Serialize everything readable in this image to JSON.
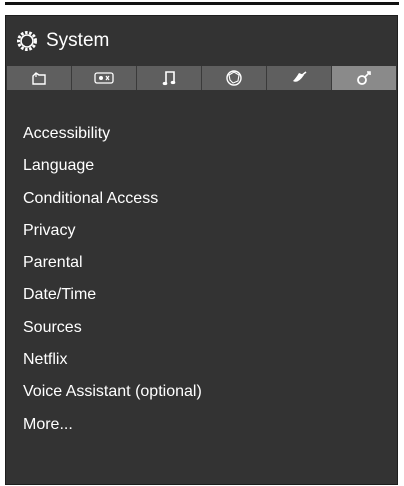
{
  "header": {
    "title": "System",
    "icon": "gear-icon"
  },
  "tabs": [
    {
      "icon": "picture-icon",
      "active": false
    },
    {
      "icon": "sound-display-icon",
      "active": false
    },
    {
      "icon": "music-note-icon",
      "active": false
    },
    {
      "icon": "network-globe-icon",
      "active": false
    },
    {
      "icon": "satellite-dish-icon",
      "active": false
    },
    {
      "icon": "system-tools-icon",
      "active": true
    }
  ],
  "menu": {
    "items": [
      "Accessibility",
      "Language",
      "Conditional Access",
      "Privacy",
      "Parental",
      "Date/Time",
      "Sources",
      "Netflix",
      "Voice Assistant (optional)",
      "More..."
    ]
  },
  "colors": {
    "panel": "#333333",
    "tab": "#5f5f5f",
    "tab_active": "#8a8a8a",
    "text": "#ffffff"
  }
}
